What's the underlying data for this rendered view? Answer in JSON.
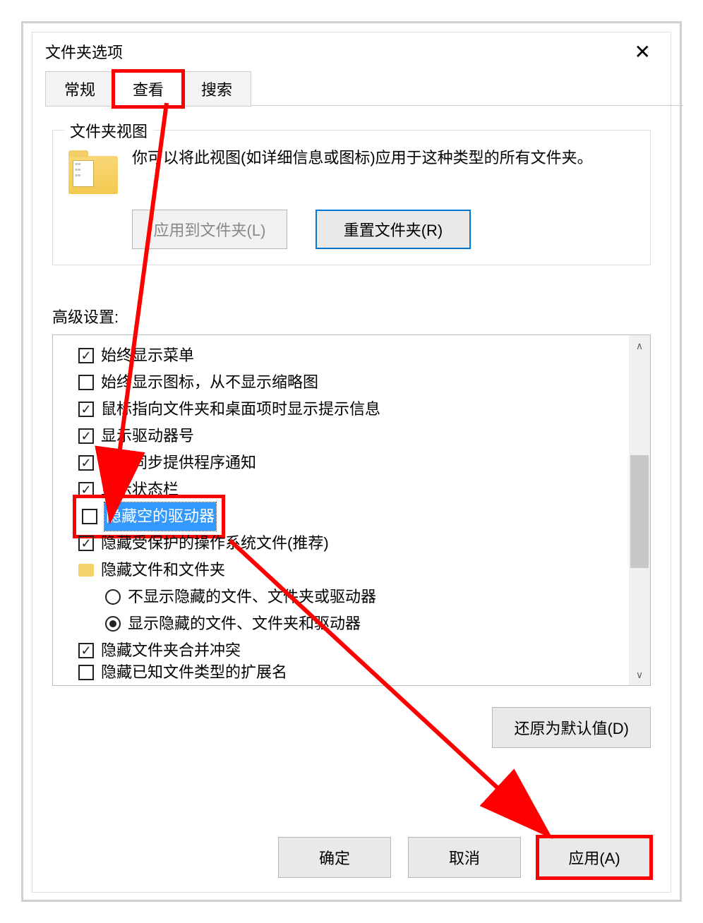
{
  "dialog": {
    "title": "文件夹选项"
  },
  "tabs": {
    "general": "常规",
    "view": "查看",
    "search": "搜索"
  },
  "folderView": {
    "groupLabel": "文件夹视图",
    "description": "你可以将此视图(如详细信息或图标)应用于这种类型的所有文件夹。",
    "applyBtn": "应用到文件夹(L)",
    "resetBtn": "重置文件夹(R)"
  },
  "advanced": {
    "label": "高级设置:",
    "items": [
      {
        "type": "check",
        "checked": true,
        "label": "始终显示菜单"
      },
      {
        "type": "check",
        "checked": false,
        "label": "始终显示图标，从不显示缩略图"
      },
      {
        "type": "check",
        "checked": true,
        "label": "鼠标指向文件夹和桌面项时显示提示信息"
      },
      {
        "type": "check",
        "checked": true,
        "label": "显示驱动器号"
      },
      {
        "type": "check",
        "checked": true,
        "label": "显示同步提供程序通知"
      },
      {
        "type": "check",
        "checked": true,
        "label": "显示状态栏"
      },
      {
        "type": "check",
        "checked": false,
        "label": "隐藏空的驱动器",
        "highlighted": true,
        "selected": true
      },
      {
        "type": "check",
        "checked": true,
        "label": "隐藏受保护的操作系统文件(推荐)"
      },
      {
        "type": "folder",
        "label": "隐藏文件和文件夹"
      },
      {
        "type": "radio",
        "checked": false,
        "label": "不显示隐藏的文件、文件夹或驱动器",
        "indent": 1
      },
      {
        "type": "radio",
        "checked": true,
        "label": "显示隐藏的文件、文件夹和驱动器",
        "indent": 1
      },
      {
        "type": "check",
        "checked": true,
        "label": "隐藏文件夹合并冲突"
      },
      {
        "type": "check",
        "checked": false,
        "label": "隐藏已知文件类型的扩展名",
        "cut": true
      }
    ]
  },
  "restoreBtn": "还原为默认值(D)",
  "bottom": {
    "ok": "确定",
    "cancel": "取消",
    "apply": "应用(A)"
  }
}
